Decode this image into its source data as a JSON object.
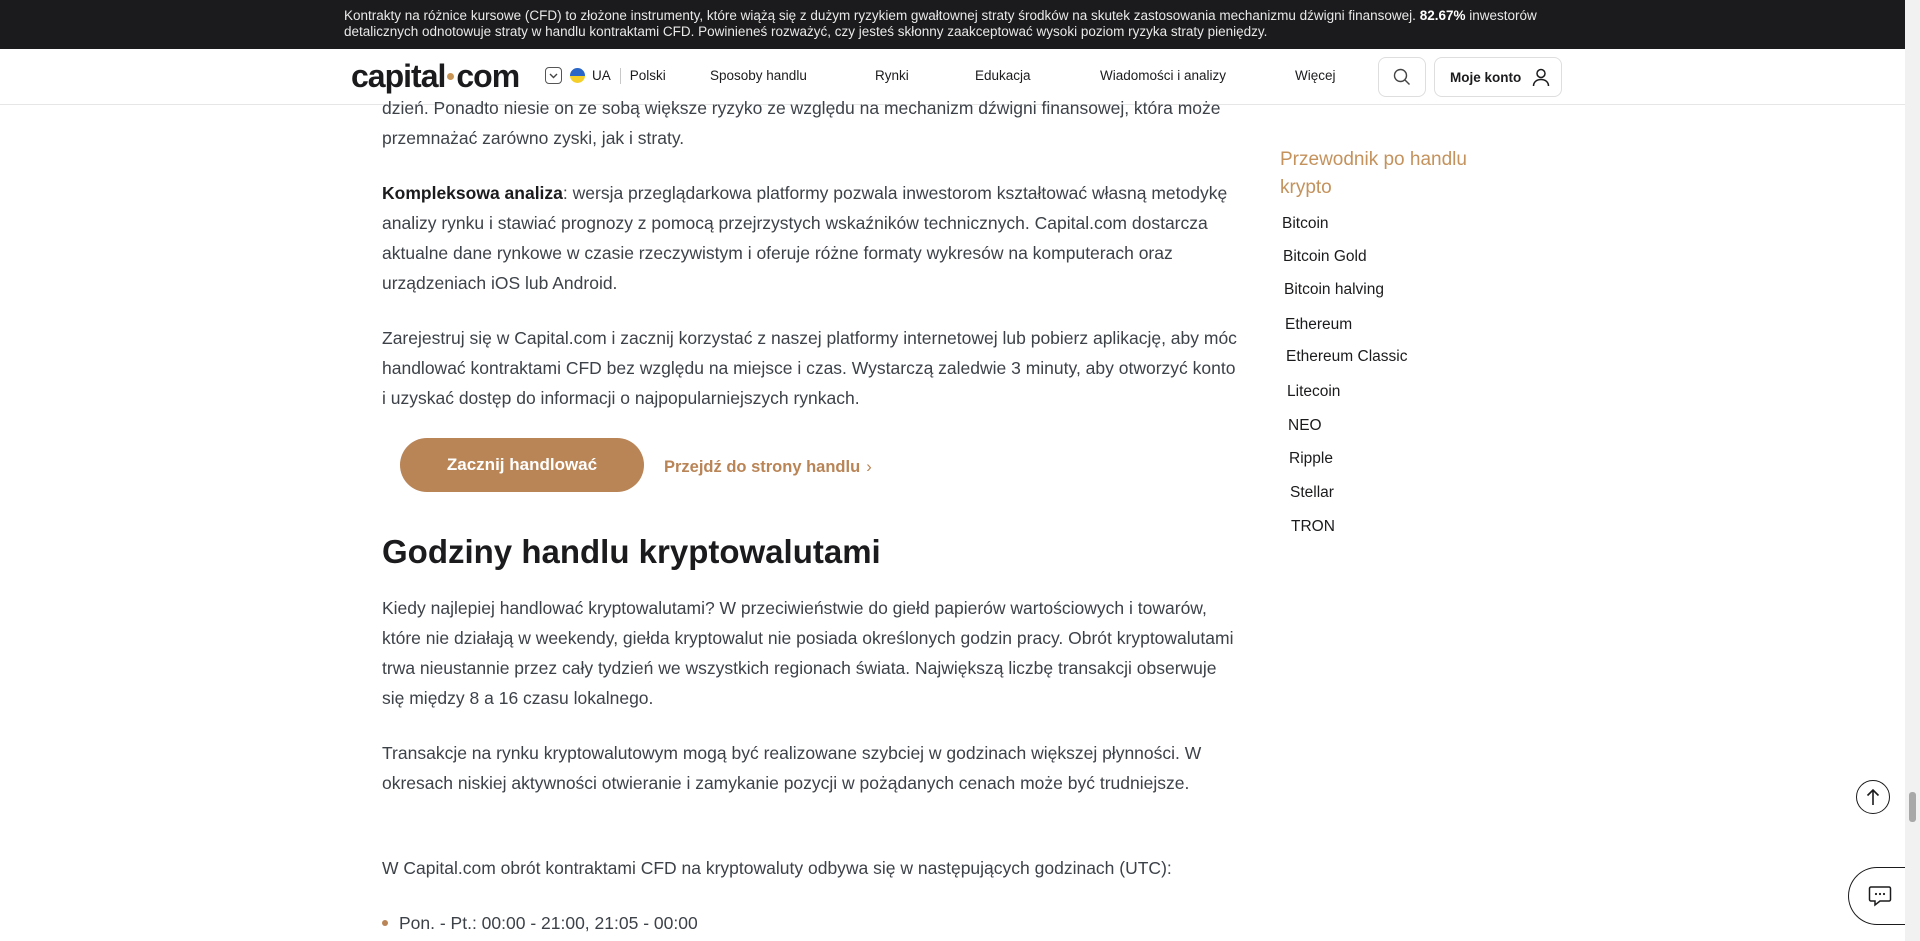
{
  "risk_banner": {
    "text": "Kontrakty na różnice kursowe (CFD) to złożone instrumenty, które wiążą się z dużym ryzykiem gwałtownej straty środków na skutek zastosowania mechanizmu dźwigni finansowej. ",
    "percent": "82.67%",
    "text_end": " inwestorów detalicznych odnotowuje straty w handlu kontraktami CFD. Powinieneś rozważyć, czy jesteś skłonny zaakceptować wysoki poziom ryzyka straty pieniędzy."
  },
  "header": {
    "logo_left": "capital",
    "logo_right": "com",
    "region": "UA",
    "language": "Polski",
    "nav": [
      "Sposoby handlu",
      "Rynki",
      "Edukacja",
      "Wiadomości i analizy",
      "Więcej"
    ],
    "account_label": "Moje konto"
  },
  "article": {
    "p1": "dzień. Ponadto niesie on ze sobą większe ryzyko ze względu na mechanizm dźwigni finansowej, która może przemnażać zarówno zyski, jak i straty.",
    "p2_bold": "Kompleksowa analiza",
    "p2": ": wersja przeglądarkowa platformy pozwala inwestorom kształtować własną metodykę analizy rynku i stawiać prognozy z pomocą przejrzystych wskaźników technicznych. Capital.com dostarcza aktualne dane rynkowe w czasie rzeczywistym i oferuje różne formaty wykresów na komputerach oraz urządzeniach iOS lub Android.",
    "p3": "Zarejestruj się w Capital.com i zacznij korzystać z naszej platformy internetowej lub pobierz aplikację, aby móc handlować kontraktami CFD bez względu na miejsce i czas. Wystarczą zaledwie 3 minuty, aby otworzyć konto i uzyskać dostęp do informacji o najpopularniejszych rynkach.",
    "cta_button": "Zacznij handlować",
    "cta_link": "Przejdź do strony handlu",
    "heading": "Godziny handlu kryptowalutami",
    "p4": "Kiedy najlepiej handlować kryptowalutami? W przeciwieństwie do giełd papierów wartościowych i towarów, które nie działają w weekendy, giełda kryptowalut nie posiada określonych godzin pracy. Obrót kryptowalutami trwa nieustannie przez cały tydzień we wszystkich regionach świata. Największą liczbę transakcji obserwuje się między 8 a 16 czasu lokalnego.",
    "p5": "Transakcje na rynku kryptowalutowym mogą być realizowane szybciej w godzinach większej płynności. W okresach niskiej aktywności otwieranie i zamykanie pozycji w pożądanych cenach może być trudniejsze.",
    "p6": "W Capital.com obrót kontraktami CFD na kryptowaluty odbywa się w następujących godzinach (UTC):",
    "bullet1": "Pon. - Pt.: 00:00 - 21:00, 21:05 - 00:00"
  },
  "sidebar": {
    "title": "Przewodnik po handlu krypto",
    "items": [
      "Bitcoin",
      "Bitcoin Gold",
      "Bitcoin halving",
      "Ethereum",
      "Ethereum Classic",
      "Litecoin",
      "NEO",
      "Ripple",
      "Stellar",
      "TRON"
    ]
  },
  "colors": {
    "accent": "#b98456",
    "banner_bg": "#1b1b1d"
  }
}
